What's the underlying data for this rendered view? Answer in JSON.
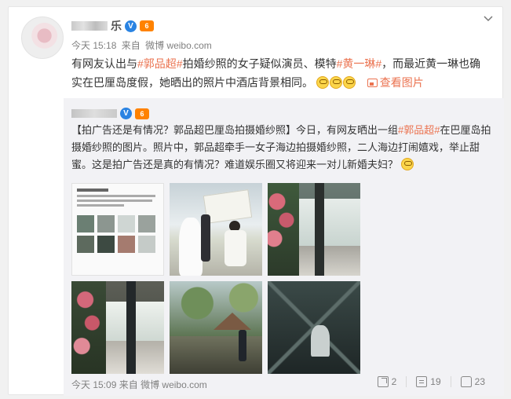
{
  "post": {
    "username_suffix": "乐",
    "v_badge": "V",
    "vip_badge": "6",
    "time": "今天 15:18",
    "source_prefix": "来自",
    "source": "微博 weibo.com",
    "text_1": "有网友认出与",
    "tag_1": "#郭品超#",
    "text_2": "拍婚纱照的女子疑似演员、模特",
    "tag_2": "#黄一琳#",
    "text_3": "，而最近黄一琳也确实在巴厘岛度假，她晒出的照片中酒店背景相同。",
    "view_images": "查看图片"
  },
  "repost": {
    "v_badge": "V",
    "vip_badge": "6",
    "text_1": "【拍广告还是有情况？郭品超巴厘岛拍摄婚纱照】今日，有网友晒出一组",
    "link": "#郭品超#",
    "text_2": "在巴厘岛拍摄婚纱照的图片。照片中，郭品超牵手一女子海边拍摄婚纱照，二人海边打闹嬉戏，举止甜蜜。这是拍广告还是真的有情况？难道娱乐圈又将迎来一对儿新婚夫妇？",
    "time": "今天 15:09",
    "source_prefix": "来自",
    "source": "微博 weibo.com",
    "shares": "2",
    "comments": "19",
    "likes": "23"
  },
  "icons": {
    "menu": "chevron-down-icon",
    "share": "share-icon",
    "comment": "comment-icon",
    "like": "like-icon"
  },
  "colors": {
    "link": "#eb7350",
    "verified": "#2a83e2",
    "vip": "#ff8200",
    "repost_bg": "#f2f2f5"
  }
}
